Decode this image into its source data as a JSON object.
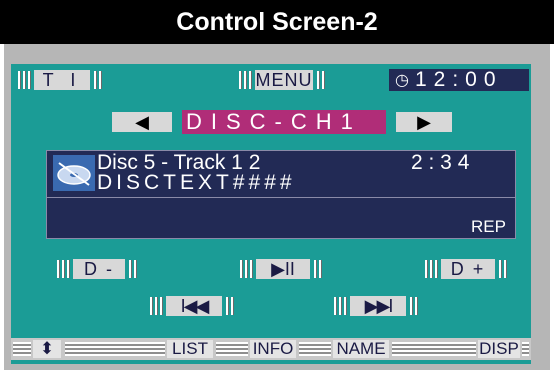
{
  "title": "Control Screen-2",
  "top": {
    "ti_label": "T I",
    "menu_label": "MENU",
    "clock": "12:00"
  },
  "source": {
    "prev_icon": "◀",
    "label": "DISC-CH1",
    "next_icon": "▶"
  },
  "info": {
    "line1_left": "Disc 5 - Track  1 2",
    "line1_time": "2 : 3 4",
    "line2": "DISCTEXT####",
    "mode": "REP"
  },
  "controls": {
    "disc_down": "D -",
    "play_pause": "▶II",
    "disc_up": "D +",
    "prev_track": "I◀◀",
    "next_track": "▶▶I"
  },
  "bottom_bar": {
    "list": "LIST",
    "info": "INFO",
    "name": "NAME",
    "disp": "DISP"
  },
  "colors": {
    "screen": "#1b9c96",
    "panel": "#222a55",
    "disc_label": "#b02d78",
    "button": "#d8d8d8"
  }
}
